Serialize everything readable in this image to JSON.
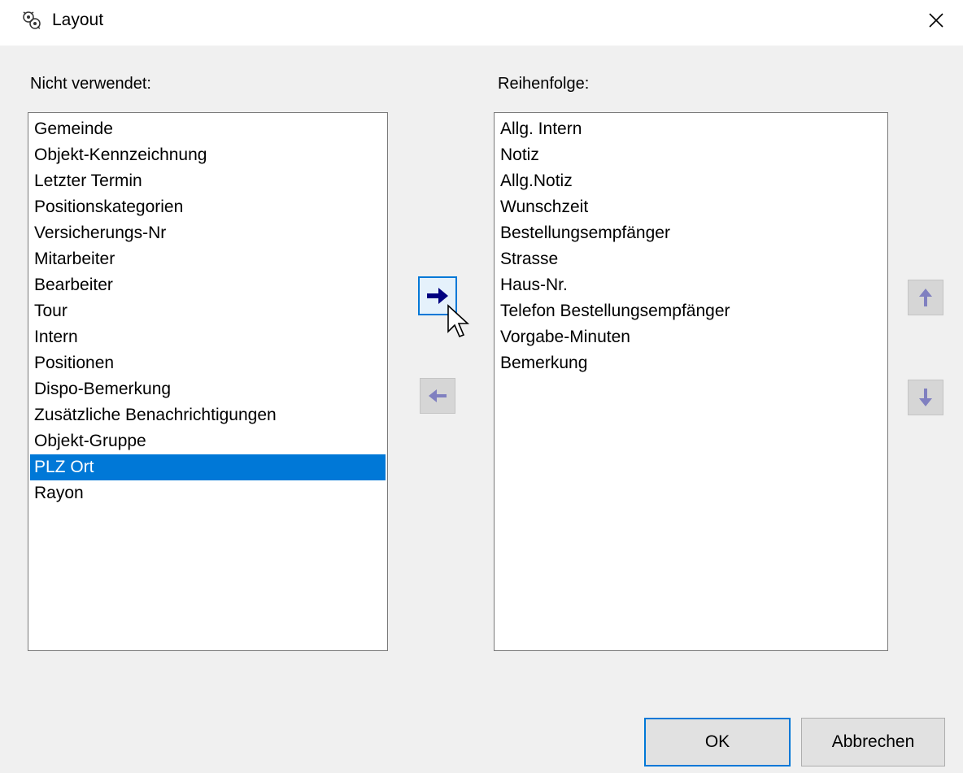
{
  "window": {
    "title": "Layout",
    "close_icon": "close-icon",
    "app_icon": "app-icon"
  },
  "left_panel": {
    "label": "Nicht verwendet:",
    "items": [
      "Gemeinde",
      "Objekt-Kennzeichnung",
      "Letzter Termin",
      "Positionskategorien",
      "Versicherungs-Nr",
      "Mitarbeiter",
      "Bearbeiter",
      "Tour",
      "Intern",
      "Positionen",
      "Dispo-Bemerkung",
      "Zusätzliche Benachrichtigungen",
      "Objekt-Gruppe",
      "PLZ Ort",
      "Rayon"
    ],
    "selected": "PLZ Ort"
  },
  "right_panel": {
    "label": "Reihenfolge:",
    "items": [
      "Allg. Intern",
      "Notiz",
      "Allg.Notiz",
      "Wunschzeit",
      "Bestellungsempfänger",
      "Strasse",
      "Haus-Nr.",
      "Telefon Bestellungsempfänger",
      "Vorgabe-Minuten",
      "Bemerkung"
    ]
  },
  "transfer_buttons": {
    "add": {
      "icon": "arrow-right-icon",
      "state": "active"
    },
    "remove": {
      "icon": "arrow-left-icon",
      "state": "disabled"
    }
  },
  "order_buttons": {
    "up": {
      "icon": "arrow-up-icon",
      "state": "disabled"
    },
    "down": {
      "icon": "arrow-down-icon",
      "state": "disabled"
    }
  },
  "footer": {
    "ok_label": "OK",
    "cancel_label": "Abbrechen"
  },
  "colors": {
    "selection": "#0078d7",
    "arrow_active": "#000080",
    "arrow_disabled": "#8080c0"
  }
}
